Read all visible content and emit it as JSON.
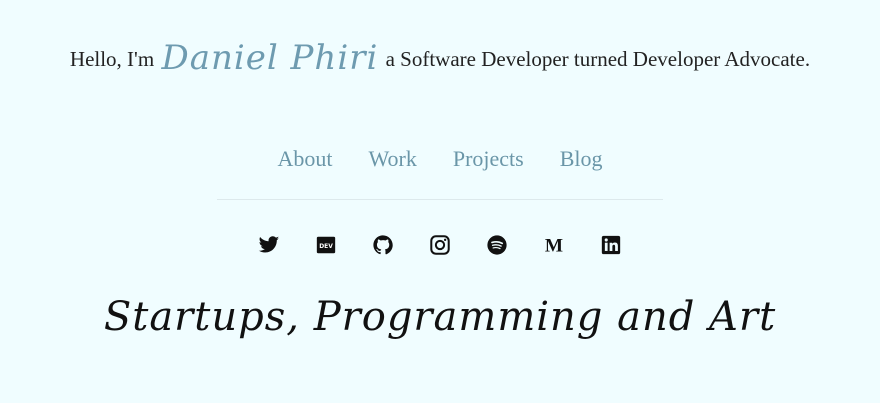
{
  "intro": {
    "prefix": "Hello, I'm",
    "name": "Daniel Phiri",
    "suffix": "a Software Developer turned Developer Advocate.",
    "name_color": "#6e9bb0"
  },
  "nav": [
    {
      "label": "About"
    },
    {
      "label": "Work"
    },
    {
      "label": "Projects"
    },
    {
      "label": "Blog"
    }
  ],
  "socials": [
    {
      "icon": "twitter-icon"
    },
    {
      "icon": "dev-icon"
    },
    {
      "icon": "github-icon"
    },
    {
      "icon": "instagram-icon"
    },
    {
      "icon": "spotify-icon"
    },
    {
      "icon": "medium-icon"
    },
    {
      "icon": "linkedin-icon"
    }
  ],
  "tagline": "Startups, Programming and Art",
  "colors": {
    "background": "#f0fdff",
    "link": "#6a96a8",
    "text": "#222222"
  }
}
